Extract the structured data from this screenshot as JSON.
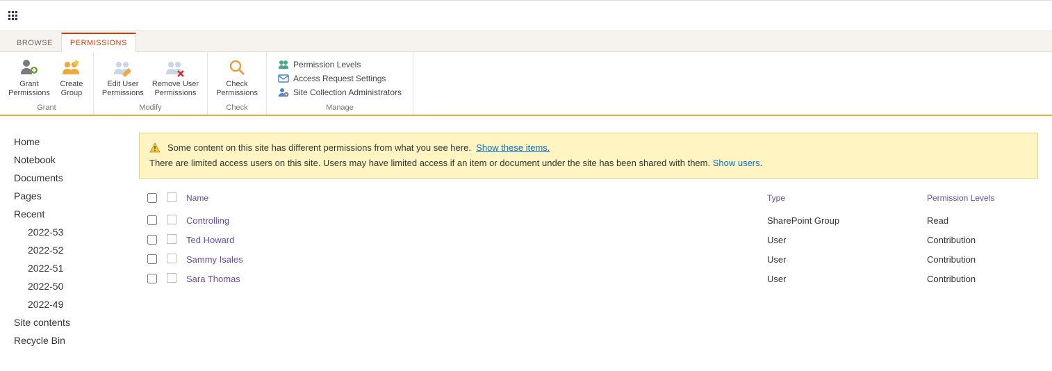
{
  "tabs": {
    "browse": "BROWSE",
    "permissions": "PERMISSIONS"
  },
  "ribbon": {
    "grant": {
      "title": "Grant",
      "grant_permissions": "Grant\nPermissions",
      "create_group": "Create\nGroup"
    },
    "modify": {
      "title": "Modify",
      "edit_user_permissions": "Edit User\nPermissions",
      "remove_user_permissions": "Remove User\nPermissions"
    },
    "check": {
      "title": "Check",
      "check_permissions": "Check\nPermissions"
    },
    "manage": {
      "title": "Manage",
      "permission_levels": "Permission Levels",
      "access_request_settings": "Access Request Settings",
      "site_collection_administrators": "Site Collection Administrators"
    }
  },
  "nav": {
    "home": "Home",
    "notebook": "Notebook",
    "documents": "Documents",
    "pages": "Pages",
    "recent": "Recent",
    "recent_items": [
      "2022-53",
      "2022-52",
      "2022-51",
      "2022-50",
      "2022-49"
    ],
    "site_contents": "Site contents",
    "recycle_bin": "Recycle Bin"
  },
  "notice": {
    "line1_text": "Some content on this site has different permissions from what you see here.",
    "line1_link": "Show these items.",
    "line2_text_a": "There are limited access users on this site. Users may have limited access if an item or document under the site has been shared with them. ",
    "line2_link": "Show users",
    "line2_text_b": "."
  },
  "table": {
    "headers": {
      "name": "Name",
      "type": "Type",
      "levels": "Permission Levels"
    },
    "rows": [
      {
        "name": "Controlling",
        "type": "SharePoint Group",
        "levels": "Read"
      },
      {
        "name": "Ted Howard",
        "type": "User",
        "levels": "Contribution"
      },
      {
        "name": "Sammy Isales",
        "type": "User",
        "levels": "Contribution"
      },
      {
        "name": "Sara Thomas",
        "type": "User",
        "levels": "Contribution"
      }
    ]
  }
}
